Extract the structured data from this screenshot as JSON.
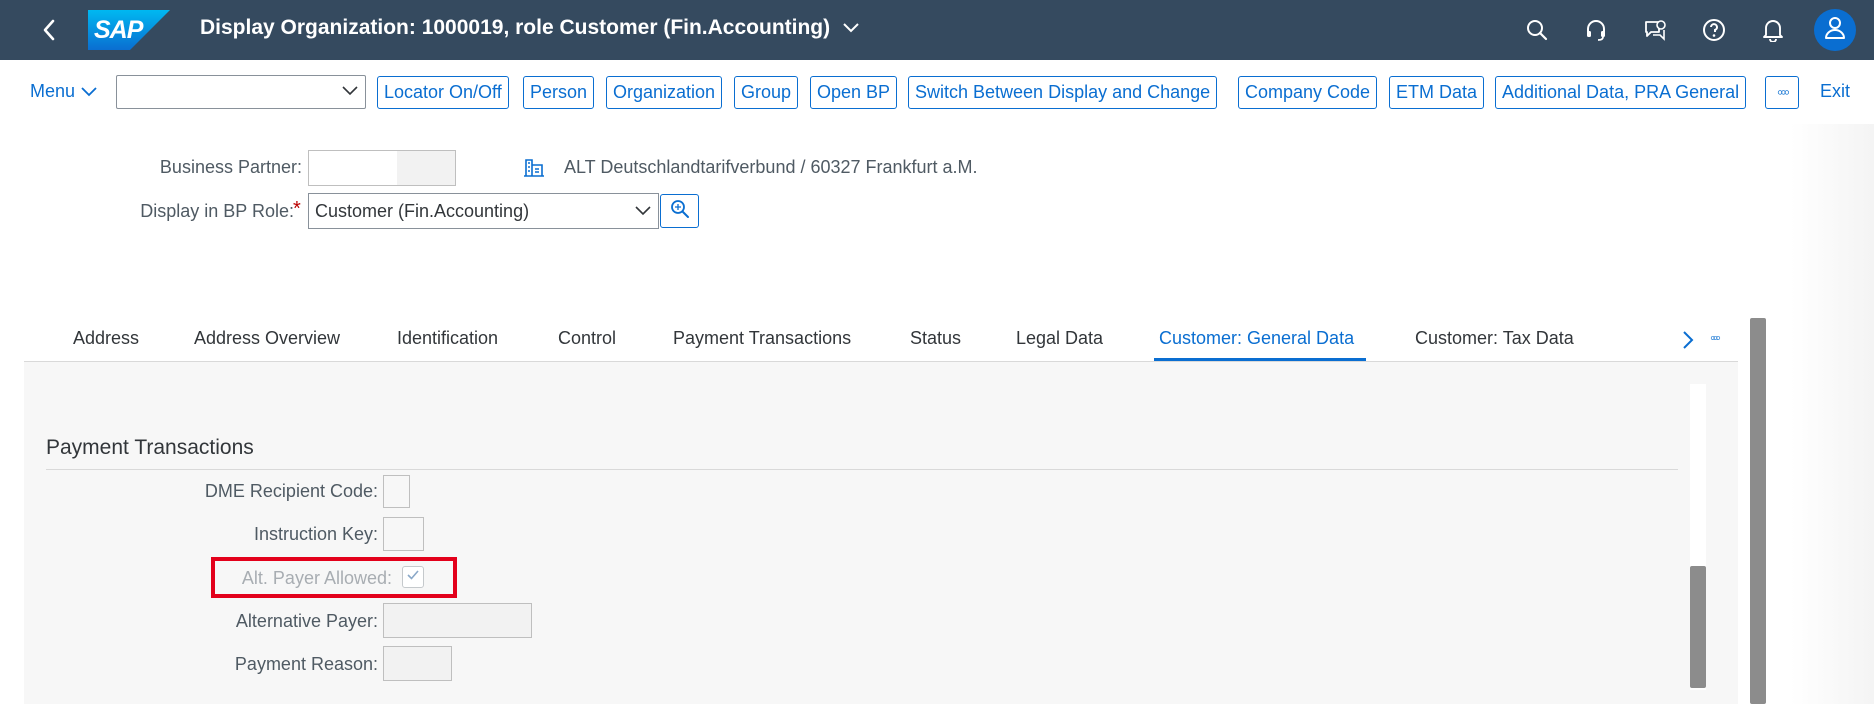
{
  "shell": {
    "title": "Display Organization: 1000019, role Customer (Fin.Accounting)",
    "logo_text": "SAP",
    "icons": [
      "back-icon",
      "search-icon",
      "headset-icon",
      "feedback-icon",
      "help-icon",
      "notification-bell-icon",
      "user-icon"
    ]
  },
  "toolbar": {
    "menu_label": "Menu",
    "combo_value": "",
    "buttons": [
      "Locator On/Off",
      "Person",
      "Organization",
      "Group",
      "Open BP",
      "Switch Between Display and Change",
      "Company Code",
      "ETM Data",
      "Additional Data, PRA General"
    ],
    "more_label": "◦◦◦",
    "exit_label": "Exit"
  },
  "header": {
    "bp_label": "Business Partner:",
    "bp_value": "",
    "bp_description": "ALT Deutschlandtarifverbund / 60327 Frankfurt a.M.",
    "role_label": "Display in BP Role:",
    "role_required": "*",
    "role_value": "Customer (Fin.Accounting)"
  },
  "tabs": {
    "items": [
      "Address",
      "Address Overview",
      "Identification",
      "Control",
      "Payment Transactions",
      "Status",
      "Legal Data",
      "Customer: General Data",
      "Customer: Tax Data"
    ],
    "active": "Customer: General Data",
    "more_label": "◦◦◦"
  },
  "section": {
    "title": "Payment Transactions",
    "fields": {
      "dme_label": "DME Recipient Code:",
      "dme_value": "",
      "instruction_label": "Instruction Key:",
      "instruction_value": "",
      "alt_payer_allowed_label": "Alt. Payer Allowed:",
      "alt_payer_allowed_checked": true,
      "alt_payer_label": "Alternative Payer:",
      "alt_payer_value": "",
      "payment_reason_label": "Payment Reason:",
      "payment_reason_value": ""
    }
  },
  "colors": {
    "shell_bg": "#354a5f",
    "accent": "#0a6ed1",
    "highlight_border": "#e3001b",
    "required": "#bb0000"
  }
}
